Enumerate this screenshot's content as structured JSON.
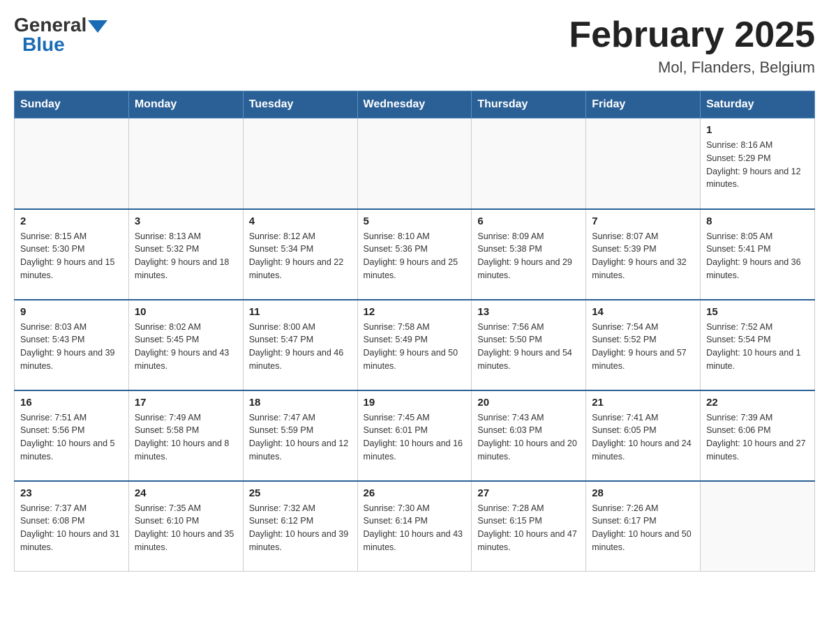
{
  "header": {
    "logo_general": "General",
    "logo_blue": "Blue",
    "month_title": "February 2025",
    "location": "Mol, Flanders, Belgium"
  },
  "days_of_week": [
    "Sunday",
    "Monday",
    "Tuesday",
    "Wednesday",
    "Thursday",
    "Friday",
    "Saturday"
  ],
  "weeks": [
    [
      {
        "day": "",
        "info": ""
      },
      {
        "day": "",
        "info": ""
      },
      {
        "day": "",
        "info": ""
      },
      {
        "day": "",
        "info": ""
      },
      {
        "day": "",
        "info": ""
      },
      {
        "day": "",
        "info": ""
      },
      {
        "day": "1",
        "info": "Sunrise: 8:16 AM\nSunset: 5:29 PM\nDaylight: 9 hours and 12 minutes."
      }
    ],
    [
      {
        "day": "2",
        "info": "Sunrise: 8:15 AM\nSunset: 5:30 PM\nDaylight: 9 hours and 15 minutes."
      },
      {
        "day": "3",
        "info": "Sunrise: 8:13 AM\nSunset: 5:32 PM\nDaylight: 9 hours and 18 minutes."
      },
      {
        "day": "4",
        "info": "Sunrise: 8:12 AM\nSunset: 5:34 PM\nDaylight: 9 hours and 22 minutes."
      },
      {
        "day": "5",
        "info": "Sunrise: 8:10 AM\nSunset: 5:36 PM\nDaylight: 9 hours and 25 minutes."
      },
      {
        "day": "6",
        "info": "Sunrise: 8:09 AM\nSunset: 5:38 PM\nDaylight: 9 hours and 29 minutes."
      },
      {
        "day": "7",
        "info": "Sunrise: 8:07 AM\nSunset: 5:39 PM\nDaylight: 9 hours and 32 minutes."
      },
      {
        "day": "8",
        "info": "Sunrise: 8:05 AM\nSunset: 5:41 PM\nDaylight: 9 hours and 36 minutes."
      }
    ],
    [
      {
        "day": "9",
        "info": "Sunrise: 8:03 AM\nSunset: 5:43 PM\nDaylight: 9 hours and 39 minutes."
      },
      {
        "day": "10",
        "info": "Sunrise: 8:02 AM\nSunset: 5:45 PM\nDaylight: 9 hours and 43 minutes."
      },
      {
        "day": "11",
        "info": "Sunrise: 8:00 AM\nSunset: 5:47 PM\nDaylight: 9 hours and 46 minutes."
      },
      {
        "day": "12",
        "info": "Sunrise: 7:58 AM\nSunset: 5:49 PM\nDaylight: 9 hours and 50 minutes."
      },
      {
        "day": "13",
        "info": "Sunrise: 7:56 AM\nSunset: 5:50 PM\nDaylight: 9 hours and 54 minutes."
      },
      {
        "day": "14",
        "info": "Sunrise: 7:54 AM\nSunset: 5:52 PM\nDaylight: 9 hours and 57 minutes."
      },
      {
        "day": "15",
        "info": "Sunrise: 7:52 AM\nSunset: 5:54 PM\nDaylight: 10 hours and 1 minute."
      }
    ],
    [
      {
        "day": "16",
        "info": "Sunrise: 7:51 AM\nSunset: 5:56 PM\nDaylight: 10 hours and 5 minutes."
      },
      {
        "day": "17",
        "info": "Sunrise: 7:49 AM\nSunset: 5:58 PM\nDaylight: 10 hours and 8 minutes."
      },
      {
        "day": "18",
        "info": "Sunrise: 7:47 AM\nSunset: 5:59 PM\nDaylight: 10 hours and 12 minutes."
      },
      {
        "day": "19",
        "info": "Sunrise: 7:45 AM\nSunset: 6:01 PM\nDaylight: 10 hours and 16 minutes."
      },
      {
        "day": "20",
        "info": "Sunrise: 7:43 AM\nSunset: 6:03 PM\nDaylight: 10 hours and 20 minutes."
      },
      {
        "day": "21",
        "info": "Sunrise: 7:41 AM\nSunset: 6:05 PM\nDaylight: 10 hours and 24 minutes."
      },
      {
        "day": "22",
        "info": "Sunrise: 7:39 AM\nSunset: 6:06 PM\nDaylight: 10 hours and 27 minutes."
      }
    ],
    [
      {
        "day": "23",
        "info": "Sunrise: 7:37 AM\nSunset: 6:08 PM\nDaylight: 10 hours and 31 minutes."
      },
      {
        "day": "24",
        "info": "Sunrise: 7:35 AM\nSunset: 6:10 PM\nDaylight: 10 hours and 35 minutes."
      },
      {
        "day": "25",
        "info": "Sunrise: 7:32 AM\nSunset: 6:12 PM\nDaylight: 10 hours and 39 minutes."
      },
      {
        "day": "26",
        "info": "Sunrise: 7:30 AM\nSunset: 6:14 PM\nDaylight: 10 hours and 43 minutes."
      },
      {
        "day": "27",
        "info": "Sunrise: 7:28 AM\nSunset: 6:15 PM\nDaylight: 10 hours and 47 minutes."
      },
      {
        "day": "28",
        "info": "Sunrise: 7:26 AM\nSunset: 6:17 PM\nDaylight: 10 hours and 50 minutes."
      },
      {
        "day": "",
        "info": ""
      }
    ]
  ]
}
